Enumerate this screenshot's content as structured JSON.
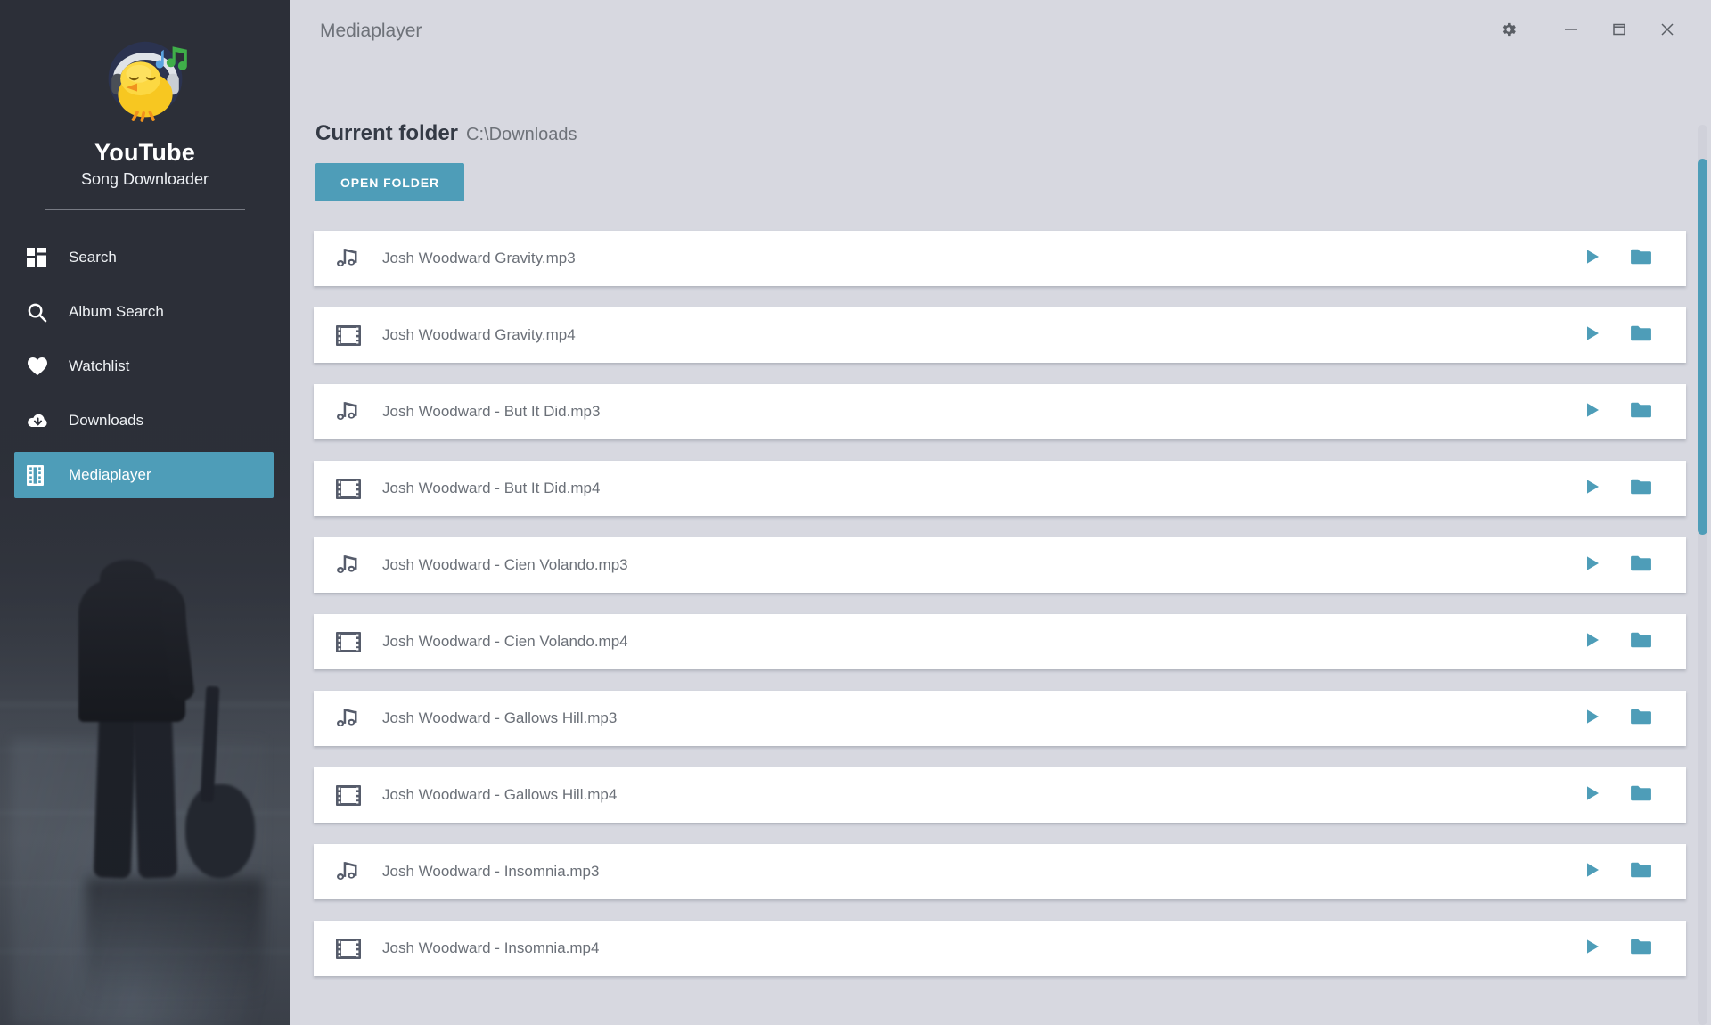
{
  "app": {
    "title": "Mediaplayer",
    "accent_color": "#4e9db8",
    "content_bg": "#d7d8e0",
    "sidebar_bg": "#2e313a"
  },
  "brand": {
    "title": "YouTube",
    "subtitle": "Song Downloader",
    "logo_icon": "chick-with-headphones-logo"
  },
  "window_controls": [
    {
      "name": "settings-button",
      "icon": "gear-icon",
      "label": "⚙"
    },
    {
      "name": "minimize-button",
      "icon": "minimize-icon",
      "label": "─"
    },
    {
      "name": "maximize-button",
      "icon": "maximize-icon",
      "label": "☐"
    },
    {
      "name": "close-button",
      "icon": "close-icon",
      "label": "✕"
    }
  ],
  "sidebar": {
    "items": [
      {
        "label": "Search",
        "icon": "grid-icon",
        "active": false
      },
      {
        "label": "Album Search",
        "icon": "magnifier-icon",
        "active": false
      },
      {
        "label": "Watchlist",
        "icon": "heart-icon",
        "active": false
      },
      {
        "label": "Downloads",
        "icon": "cloud-download-icon",
        "active": false
      },
      {
        "label": "Mediaplayer",
        "icon": "film-icon",
        "active": true
      }
    ]
  },
  "folder": {
    "heading": "Current folder",
    "path": "C:\\Downloads",
    "open_button": "OPEN FOLDER"
  },
  "file_list": {
    "play_icon": "play-icon",
    "folder_icon": "folder-icon",
    "audio_icon": "music-note-icon",
    "video_icon": "film-strip-icon",
    "rows": [
      {
        "name": "Josh Woodward Gravity.mp3",
        "type": "audio"
      },
      {
        "name": "Josh Woodward Gravity.mp4",
        "type": "video"
      },
      {
        "name": "Josh Woodward - But It Did.mp3",
        "type": "audio"
      },
      {
        "name": "Josh Woodward - But It Did.mp4",
        "type": "video"
      },
      {
        "name": "Josh Woodward - Cien Volando.mp3",
        "type": "audio"
      },
      {
        "name": "Josh Woodward - Cien Volando.mp4",
        "type": "video"
      },
      {
        "name": "Josh Woodward - Gallows Hill.mp3",
        "type": "audio"
      },
      {
        "name": "Josh Woodward - Gallows Hill.mp4",
        "type": "video"
      },
      {
        "name": "Josh Woodward - Insomnia.mp3",
        "type": "audio"
      },
      {
        "name": "Josh Woodward - Insomnia.mp4",
        "type": "video"
      }
    ]
  },
  "scrollbar": {
    "name": "vertical-scrollbar"
  }
}
